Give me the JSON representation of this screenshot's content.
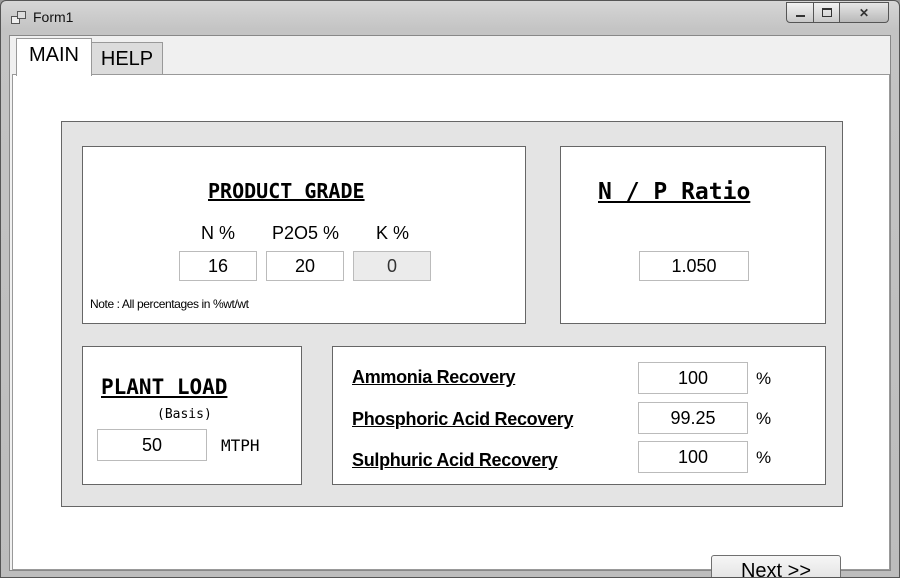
{
  "window": {
    "title": "Form1",
    "controls": {
      "minimize": "minimize",
      "maximize": "maximize",
      "close": "✕"
    }
  },
  "tabs": [
    {
      "label": "MAIN",
      "selected": true
    },
    {
      "label": "HELP",
      "selected": false
    }
  ],
  "product_grade": {
    "heading": "PRODUCT GRADE",
    "fields": [
      {
        "label": "N %",
        "value": "16"
      },
      {
        "label": "P2O5 %",
        "value": "20"
      },
      {
        "label": "K %",
        "value": "0",
        "readonly": true
      }
    ],
    "note": "Note : All percentages in %wt/wt"
  },
  "np_ratio": {
    "heading": "N / P Ratio",
    "value": "1.050"
  },
  "plant_load": {
    "heading": "PLANT LOAD",
    "subheading": "(Basis)",
    "value": "50",
    "unit": "MTPH"
  },
  "recoveries": [
    {
      "label": "Ammonia Recovery",
      "value": "100",
      "unit": "%"
    },
    {
      "label": "Phosphoric Acid Recovery",
      "value": "99.25",
      "unit": "%"
    },
    {
      "label": "Sulphuric Acid Recovery",
      "value": "100",
      "unit": "%"
    }
  ],
  "next_button": {
    "label": "Next >>"
  }
}
